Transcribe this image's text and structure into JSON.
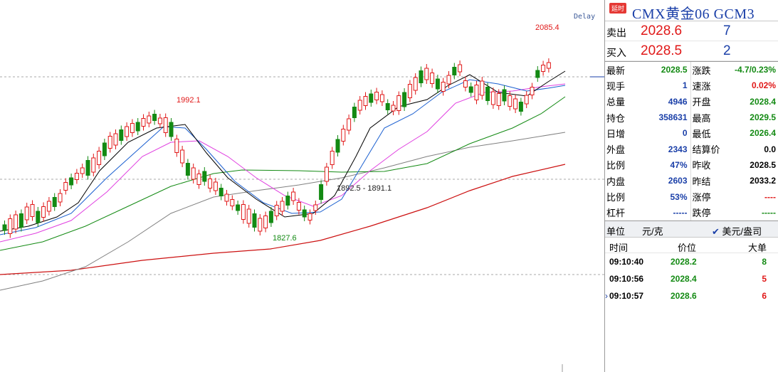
{
  "chart": {
    "delay_label": "Delay",
    "annotations": {
      "high_1": "1992.1",
      "low_1": "1827.6",
      "range": "1892.5 - 1891.1",
      "high_2": "2085.4"
    },
    "colors": {
      "up": "#e01818",
      "down": "#138a13",
      "ma5": "#000000",
      "ma10": "#1a5fd0",
      "ma20": "#e040e0",
      "ma40": "#138a13",
      "ma60": "#808080",
      "ma120": "#cc1010"
    }
  },
  "panel": {
    "badge": "延时",
    "title": "CMX黄金06  GCM3",
    "ask": {
      "label": "卖出",
      "price": "2028.6",
      "qty": "7"
    },
    "bid": {
      "label": "买入",
      "price": "2028.5",
      "qty": "2"
    },
    "stats": [
      {
        "l1": "最新",
        "v1": "2028.5",
        "c1": "green",
        "l2": "涨跌",
        "v2": "-4.7/0.23%",
        "c2": "green"
      },
      {
        "l1": "现手",
        "v1": "1",
        "c1": "blue",
        "l2": "速涨",
        "v2": "0.02%",
        "c2": "red"
      },
      {
        "l1": "总量",
        "v1": "4946",
        "c1": "blue",
        "l2": "开盘",
        "v2": "2028.4",
        "c2": "green"
      },
      {
        "l1": "持仓",
        "v1": "358631",
        "c1": "blue",
        "l2": "最高",
        "v2": "2029.5",
        "c2": "green"
      },
      {
        "l1": "日增",
        "v1": "0",
        "c1": "blue",
        "l2": "最低",
        "v2": "2026.4",
        "c2": "green"
      },
      {
        "l1": "外盘",
        "v1": "2343",
        "c1": "blue",
        "l2": "结算价",
        "v2": "0.0",
        "c2": "black"
      },
      {
        "l1": "比例",
        "v1": "47%",
        "c1": "blue",
        "l2": "昨收",
        "v2": "2028.5",
        "c2": "black"
      },
      {
        "l1": "内盘",
        "v1": "2603",
        "c1": "blue",
        "l2": "昨结",
        "v2": "2033.2",
        "c2": "black"
      },
      {
        "l1": "比例",
        "v1": "53%",
        "c1": "blue",
        "l2": "涨停",
        "v2": "----",
        "c2": "red"
      },
      {
        "l1": "杠杆",
        "v1": "-----",
        "c1": "blue",
        "l2": "跌停",
        "v2": "-----",
        "c2": "green"
      }
    ],
    "unit": {
      "label": "单位",
      "value": "元/克",
      "toggle": "美元/盎司"
    },
    "ticks_header": {
      "time": "时间",
      "price": "价位",
      "size": "大单"
    },
    "ticks": [
      {
        "time": "09:10:40",
        "price": "2028.2",
        "size": "8",
        "size_color": "green"
      },
      {
        "time": "09:10:56",
        "price": "2028.4",
        "size": "5",
        "size_color": "red"
      },
      {
        "time": "09:10:57",
        "price": "2028.6",
        "size": "6",
        "size_color": "red"
      }
    ]
  }
}
